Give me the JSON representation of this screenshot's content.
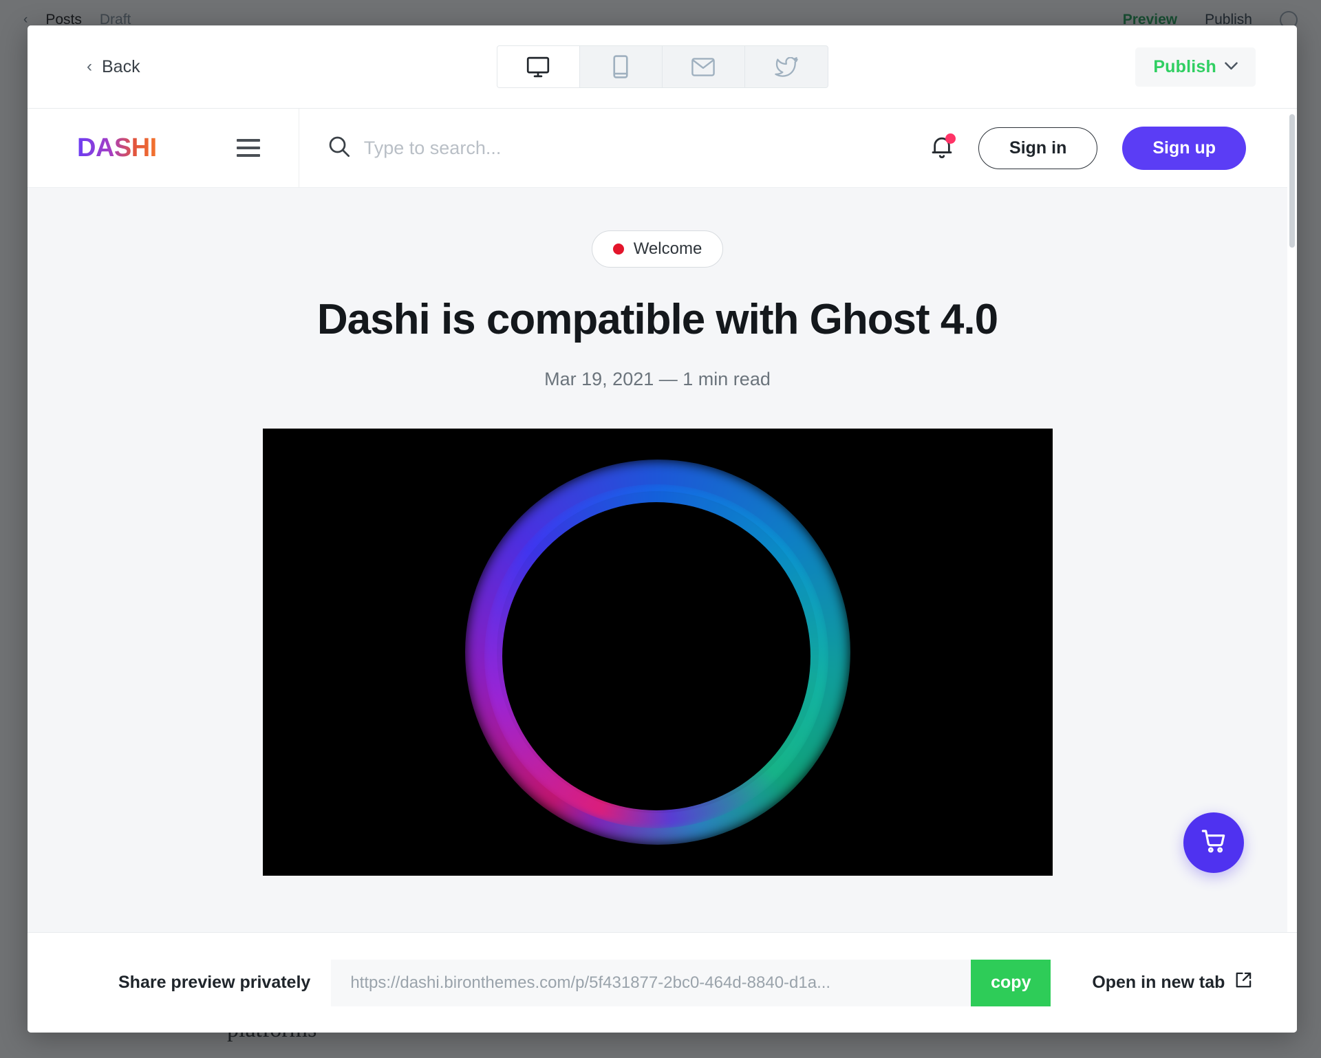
{
  "background_editor": {
    "back_label": "Posts",
    "status_label": "Draft",
    "preview_label": "Preview",
    "publish_label": "Publish",
    "settings_icon": "gear-icon",
    "body_excerpt": "platforms"
  },
  "modal": {
    "back_label": "Back",
    "view_modes": [
      {
        "name": "desktop",
        "icon": "monitor-icon",
        "active": true
      },
      {
        "name": "mobile",
        "icon": "phone-icon",
        "active": false
      },
      {
        "name": "email",
        "icon": "envelope-icon",
        "active": false
      },
      {
        "name": "twitter",
        "icon": "twitter-icon",
        "active": false
      }
    ],
    "publish_button": {
      "label": "Publish",
      "caret": "chevron-down-icon",
      "color": "#30cf62"
    }
  },
  "site": {
    "logo_text": "DASHI",
    "logo_gradient": [
      "#6c3df4",
      "#f3742d"
    ],
    "menu_icon": "hamburger-icon",
    "search": {
      "icon": "search-icon",
      "placeholder": "Type to search...",
      "value": ""
    },
    "notifications": {
      "icon": "bell-icon",
      "has_unread": true,
      "dot_color": "#ff3366"
    },
    "sign_in_label": "Sign in",
    "sign_up_label": "Sign up",
    "sign_up_color": "#5b3df5",
    "cart_fab": {
      "icon": "shopping-cart-icon",
      "color": "#4f32f0"
    }
  },
  "post": {
    "tag": "Welcome",
    "tag_dot_color": "#e3152b",
    "title": "Dashi is compatible with Ghost 4.0",
    "date": "Mar 19, 2021",
    "separator": "—",
    "read_time": "1 min read",
    "feature_image_alt": "colorful glowing ring on black background"
  },
  "share_bar": {
    "label": "Share preview privately",
    "url": "https://dashi.bironthemes.com/p/5f431877-2bc0-464d-8840-d1a...",
    "copy_label": "copy",
    "copy_color": "#2ecc58",
    "open_label": "Open in new tab",
    "open_icon": "external-link-icon"
  }
}
